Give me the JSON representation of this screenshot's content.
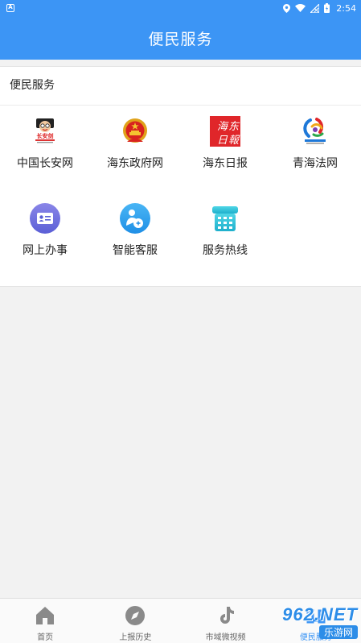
{
  "status_bar": {
    "left_icon": "notification-a-icon",
    "time": "2:54",
    "icons": [
      "location-icon",
      "wifi-icon",
      "no-signal-icon",
      "battery-icon"
    ]
  },
  "header": {
    "title": "便民服务"
  },
  "section": {
    "title": "便民服务",
    "items": [
      {
        "label": "中国长安网",
        "icon": "changan-logo-icon"
      },
      {
        "label": "海东政府网",
        "icon": "national-emblem-icon"
      },
      {
        "label": "海东日报",
        "icon": "haidong-daily-logo-icon"
      },
      {
        "label": "青海法网",
        "icon": "qinghai-law-logo-icon"
      },
      {
        "label": "网上办事",
        "icon": "id-card-icon"
      },
      {
        "label": "智能客服",
        "icon": "customer-service-icon"
      },
      {
        "label": "服务热线",
        "icon": "phone-hotline-icon"
      }
    ]
  },
  "bottom_nav": {
    "tabs": [
      {
        "label": "首页",
        "icon": "home-icon",
        "active": false
      },
      {
        "label": "上报历史",
        "icon": "compass-icon",
        "active": false
      },
      {
        "label": "市域微视频",
        "icon": "tiktok-icon",
        "active": false
      },
      {
        "label": "便民服务",
        "icon": "service-icon",
        "active": true
      }
    ]
  },
  "watermark": {
    "top": "962.NET",
    "bottom": "乐游网"
  },
  "colors": {
    "primary": "#3c95f5",
    "background": "#f2f2f2",
    "text": "#222222"
  }
}
